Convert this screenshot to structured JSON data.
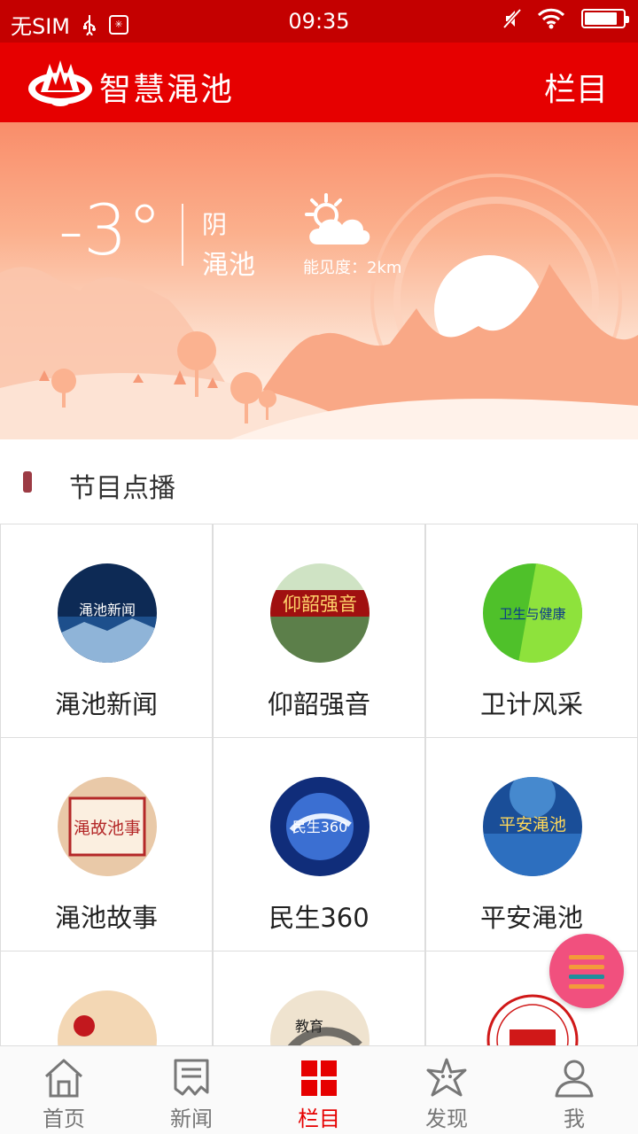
{
  "status_bar": {
    "carrier": "无SIM",
    "time": "09:35",
    "battery_level": 0.85
  },
  "header": {
    "app_title": "智慧渑池",
    "columns_label": "栏目"
  },
  "weather": {
    "temperature": "-3°",
    "condition": "阴",
    "city": "渑池",
    "visibility": "能见度：2km"
  },
  "section": {
    "title": "节目点播"
  },
  "programs": [
    {
      "name": "渑池新闻",
      "badge": "渑池新闻"
    },
    {
      "name": "仰韶强音",
      "badge": "仰韶强音"
    },
    {
      "name": "卫计风采",
      "badge": "卫生与健康"
    },
    {
      "name": "渑池故事",
      "badge": "渑故池事"
    },
    {
      "name": "民生360",
      "badge": "民生360"
    },
    {
      "name": "平安渑池",
      "badge": "平安渑池"
    },
    {
      "name": "",
      "badge": ""
    },
    {
      "name": "",
      "badge": "教育"
    },
    {
      "name": "",
      "badge": ""
    }
  ],
  "bottom_nav": [
    {
      "label": "首页",
      "icon": "home-icon"
    },
    {
      "label": "新闻",
      "icon": "news-icon"
    },
    {
      "label": "栏目",
      "icon": "grid-icon",
      "active": true
    },
    {
      "label": "发现",
      "icon": "starfish-icon"
    },
    {
      "label": "我",
      "icon": "user-icon"
    }
  ],
  "colors": {
    "status_bar": "#c40000",
    "header": "#e60000",
    "active_tab": "#e60000",
    "fab": "#f1507e"
  }
}
